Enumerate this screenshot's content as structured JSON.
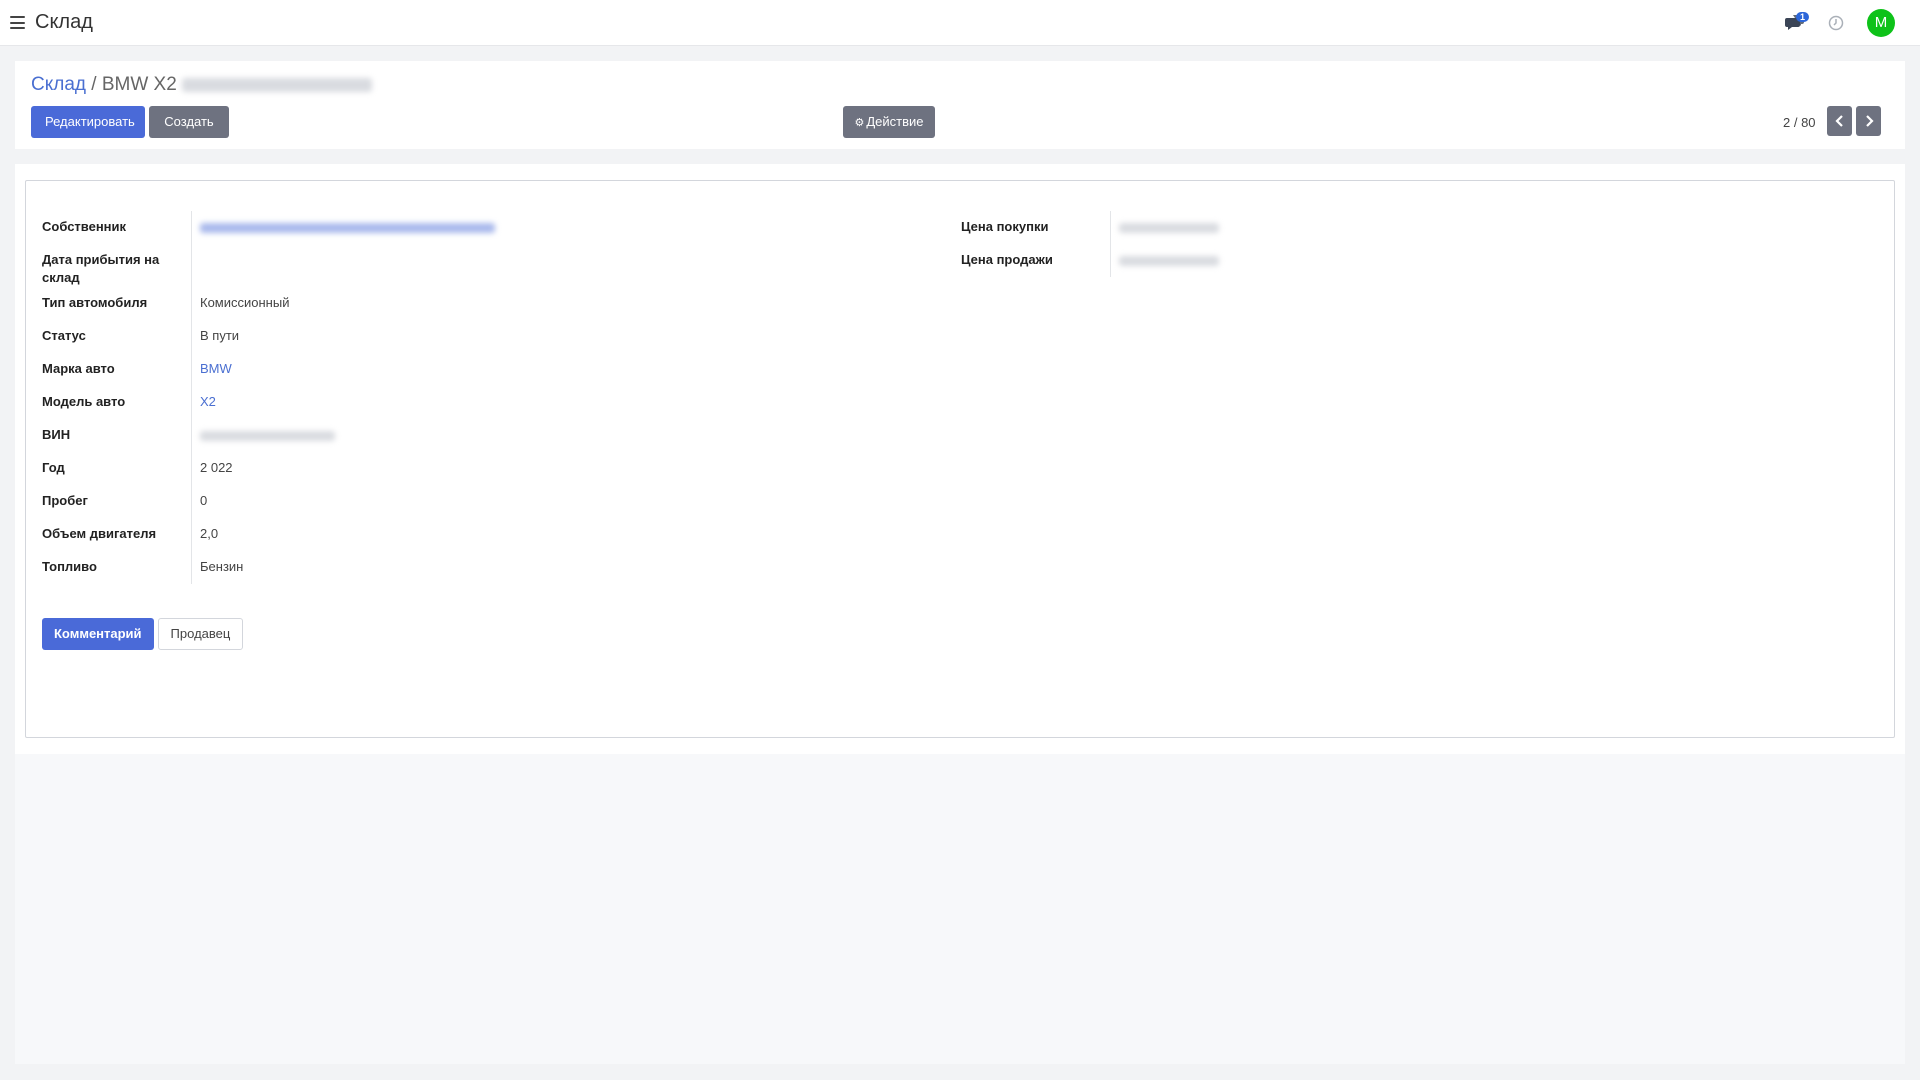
{
  "navbar": {
    "title": "Склад",
    "chat_badge": "1",
    "avatar_initial": "M",
    "avatar_color": "#0ec219"
  },
  "breadcrumb": {
    "parent": "Склад",
    "separator": "/",
    "current": "BMW X2"
  },
  "toolbar": {
    "edit_label": "Редактировать",
    "create_label": "Создать",
    "action_label": "Действие",
    "pager": "2 / 80"
  },
  "fields_left": [
    {
      "label": "Собственник",
      "value": "",
      "type": "blurred-link"
    },
    {
      "label": "Дата прибытия на склад",
      "value": "",
      "type": "text"
    },
    {
      "label": "Тип автомобиля",
      "value": "Комиссионный",
      "type": "text"
    },
    {
      "label": "Статус",
      "value": "В пути",
      "type": "text"
    },
    {
      "label": "Марка авто",
      "value": "BMW",
      "type": "link"
    },
    {
      "label": "Модель авто",
      "value": "X2",
      "type": "link"
    },
    {
      "label": "ВИН",
      "value": "",
      "type": "blurred"
    },
    {
      "label": "Год",
      "value": "2 022",
      "type": "text"
    },
    {
      "label": "Пробег",
      "value": "0",
      "type": "text"
    },
    {
      "label": "Объем двигателя",
      "value": "2,0",
      "type": "text"
    },
    {
      "label": "Топливо",
      "value": "Бензин",
      "type": "text"
    }
  ],
  "fields_right": [
    {
      "label": "Цена покупки",
      "value": "",
      "type": "blurred"
    },
    {
      "label": "Цена продажи",
      "value": "",
      "type": "blurred"
    }
  ],
  "tabs": [
    {
      "label": "Комментарий",
      "active": true
    },
    {
      "label": "Продавец",
      "active": false
    }
  ],
  "colors": {
    "primary": "#4a6ad8",
    "secondary": "#6e7280",
    "link": "#4a6fd1"
  }
}
